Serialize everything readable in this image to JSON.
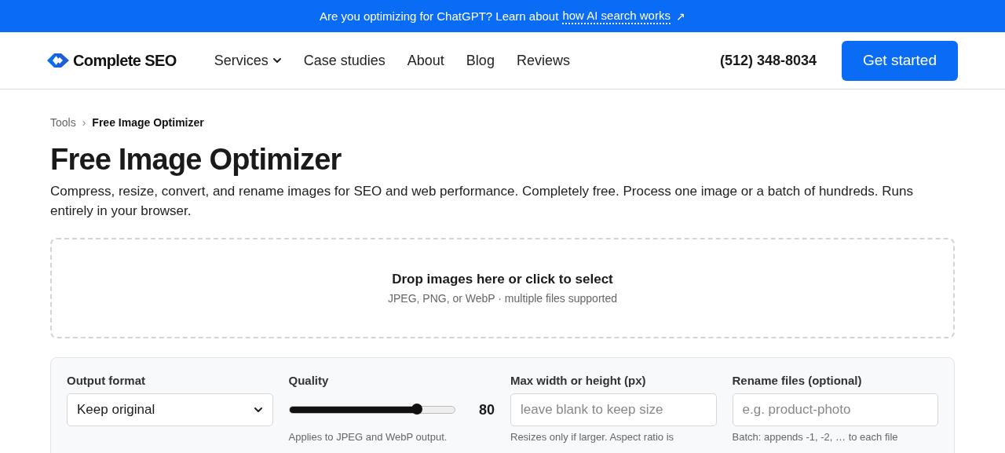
{
  "banner": {
    "text": "Are you optimizing for ChatGPT? Learn about",
    "link": "how AI search works",
    "link_icon": "↗"
  },
  "header": {
    "logo": "Complete SEO",
    "nav": [
      {
        "label": "Services",
        "dropdown": true
      },
      {
        "label": "Case studies",
        "dropdown": false
      },
      {
        "label": "About",
        "dropdown": false
      },
      {
        "label": "Blog",
        "dropdown": false
      },
      {
        "label": "Reviews",
        "dropdown": false
      }
    ],
    "phone": "(512) 348-8034",
    "cta": "Get started"
  },
  "breadcrumb": [
    {
      "label": "Tools",
      "current": false
    },
    {
      "label": "Free Image Optimizer",
      "current": true
    }
  ],
  "breadcrumb_separator": "›",
  "title": "Free Image Optimizer",
  "description": "Compress, resize, convert, and rename images for SEO and web performance. Completely free. Process one image or a batch of hundreds. Runs entirely in your browser.",
  "dropzone": {
    "title": "Drop images here or click to select",
    "hint": "JPEG, PNG, or WebP · multiple files supported"
  },
  "settings": [
    {
      "kind": "select",
      "label": "Output format",
      "value": "Keep original"
    },
    {
      "kind": "slider",
      "label": "Quality",
      "level": 0.77,
      "reading": "80",
      "help": "Applies to JPEG and WebP output."
    },
    {
      "kind": "input",
      "label": "Max width or height (px)",
      "placeholder": "leave blank to keep size",
      "help": "Resizes only if larger. Aspect ratio is"
    },
    {
      "kind": "input",
      "label": "Rename files (optional)",
      "placeholder": "e.g. product-photo",
      "help": "Batch: appends -1, -2, … to each file"
    }
  ]
}
